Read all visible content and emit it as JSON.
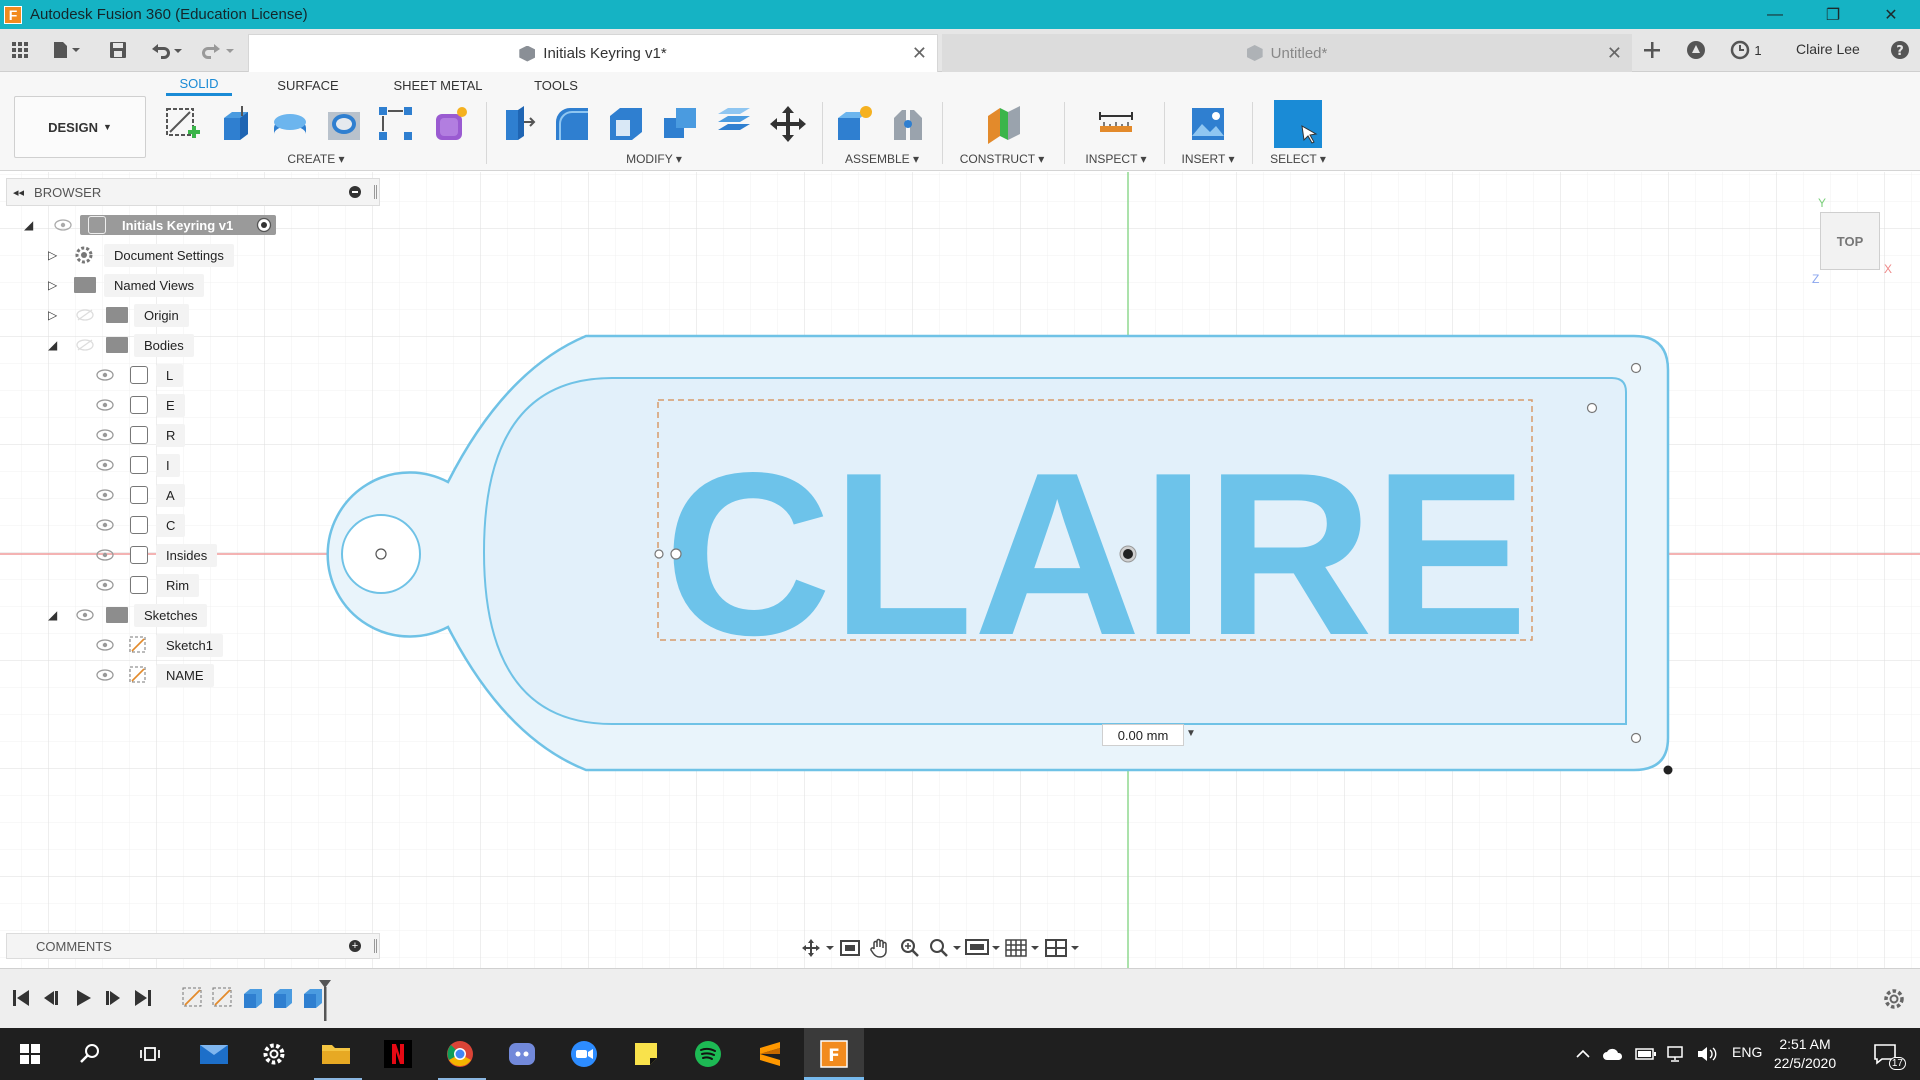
{
  "window": {
    "title": "Autodesk Fusion 360 (Education License)",
    "app_icon_letter": "F",
    "minimize": "—",
    "restore": "❐",
    "close": "✕"
  },
  "tabs": {
    "active": {
      "label": "Initials Keyring v1*",
      "close": "✕"
    },
    "inactive": {
      "label": "Untitled*",
      "close": "✕"
    },
    "job_count": "1",
    "user": "Claire Lee"
  },
  "ribbon": {
    "workspace": "DESIGN",
    "tabs": [
      "SOLID",
      "SURFACE",
      "SHEET METAL",
      "TOOLS"
    ],
    "groups": {
      "create": "CREATE",
      "modify": "MODIFY",
      "assemble": "ASSEMBLE",
      "construct": "CONSTRUCT",
      "inspect": "INSPECT",
      "insert": "INSERT",
      "select": "SELECT"
    }
  },
  "browser": {
    "title": "BROWSER",
    "root": "Initials Keyring v1",
    "items": {
      "document_settings": "Document Settings",
      "named_views": "Named Views",
      "origin": "Origin",
      "bodies": "Bodies",
      "sketches": "Sketches"
    },
    "bodies": [
      "L",
      "E",
      "R",
      "I",
      "A",
      "C",
      "Insides",
      "Rim"
    ],
    "sketches": [
      "Sketch1",
      "NAME"
    ]
  },
  "comments": {
    "title": "COMMENTS"
  },
  "canvas": {
    "text": "CLAIRE",
    "dimension_value": "0.00 mm",
    "viewcube": "TOP",
    "axis_y": "Y",
    "axis_x": "X",
    "axis_z": "Z"
  },
  "taskbar": {
    "language": "ENG",
    "time": "2:51 AM",
    "date": "22/5/2020",
    "notification_count": "17"
  },
  "colors": {
    "titlebar": "#15b3c4",
    "accent": "#1a8bd6",
    "text_fill": "#6dc3ea",
    "plate_fill": "#e9f4fb",
    "plate_stroke": "#6fc2e6"
  }
}
